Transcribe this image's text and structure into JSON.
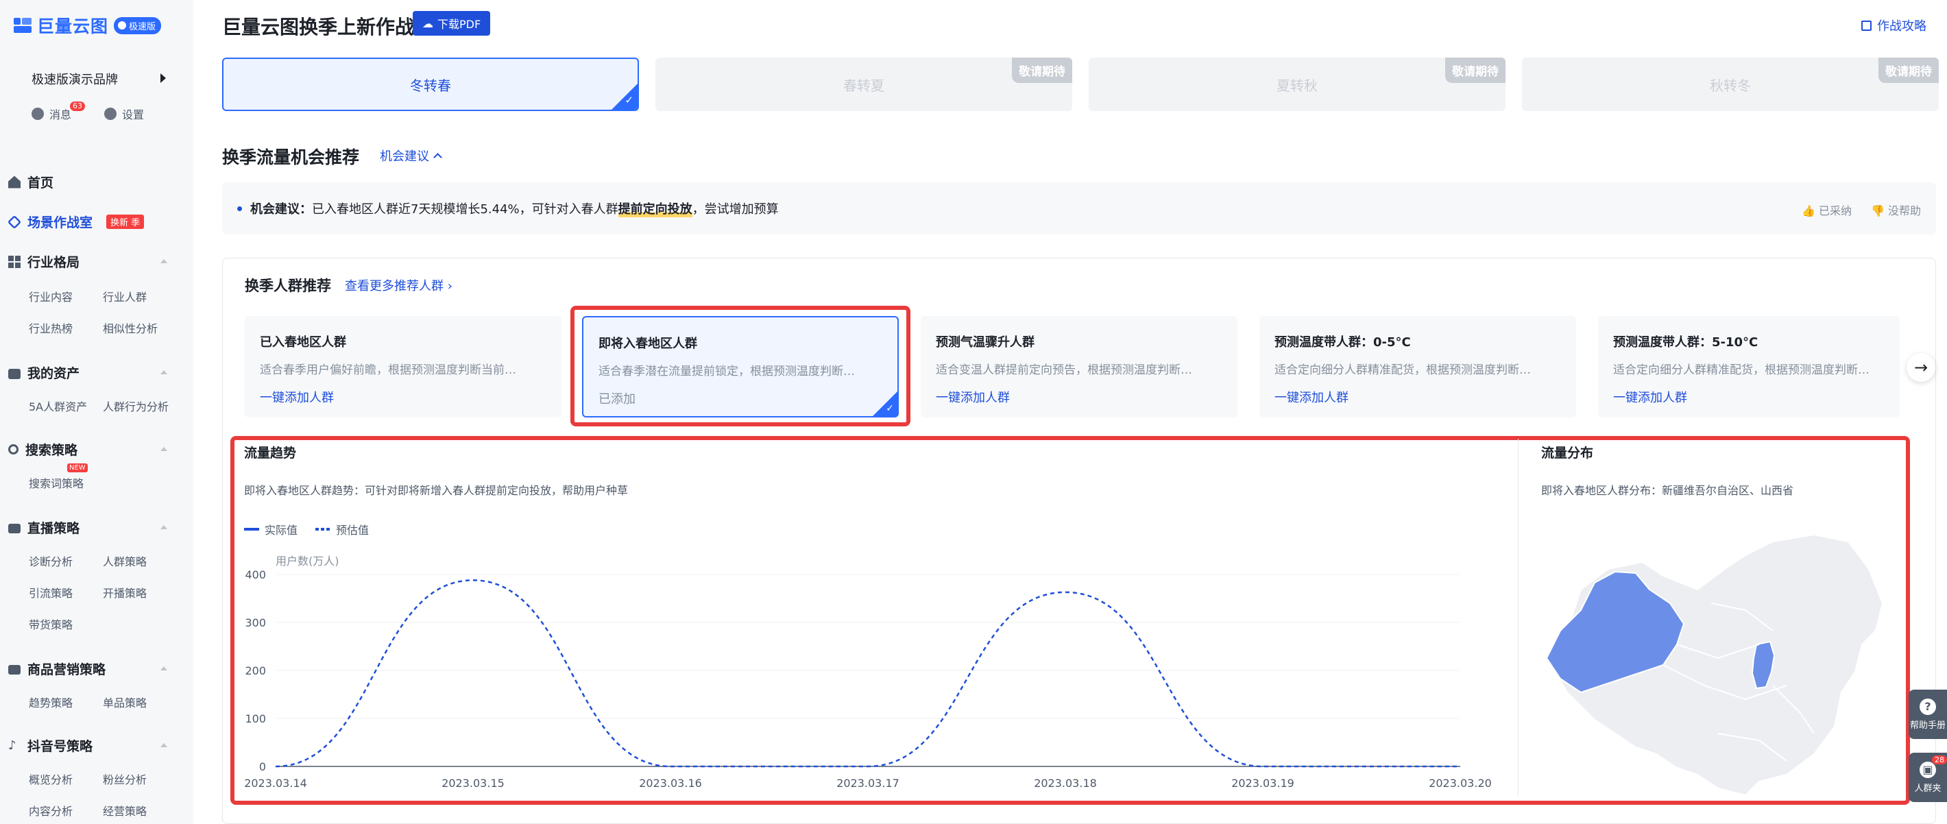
{
  "app": {
    "logo_text": "巨量云图",
    "logo_badge": "极速版",
    "brand": "极速版演示品牌",
    "messages_label": "消息",
    "messages_count": "63",
    "settings_label": "设置"
  },
  "sidebar": {
    "home": "首页",
    "scene": {
      "label": "场景作战室",
      "tag": "换新 季"
    },
    "industry": {
      "label": "行业格局",
      "items": [
        "行业内容",
        "行业人群",
        "行业热榜",
        "相似性分析"
      ]
    },
    "assets": {
      "label": "我的资产",
      "items": [
        "5A人群资产",
        "人群行为分析"
      ]
    },
    "search": {
      "label": "搜索策略",
      "items": [
        "搜索词策略"
      ],
      "new_tag": "NEW"
    },
    "live": {
      "label": "直播策略",
      "items": [
        "诊断分析",
        "人群策略",
        "引流策略",
        "开播策略",
        "带货策略"
      ]
    },
    "goods": {
      "label": "商品营销策略",
      "items": [
        "趋势策略",
        "单品策略"
      ]
    },
    "douyin": {
      "label": "抖音号策略",
      "items": [
        "概览分析",
        "粉丝分析",
        "内容分析",
        "经营策略"
      ]
    }
  },
  "header": {
    "title": "巨量云图换季上新作战",
    "pdf_button": "下载PDF",
    "guide_link": "作战攻略"
  },
  "seasons": [
    {
      "label": "冬转春",
      "active": true,
      "tag": ""
    },
    {
      "label": "春转夏",
      "active": false,
      "tag": "敬请期待"
    },
    {
      "label": "夏转秋",
      "active": false,
      "tag": "敬请期待"
    },
    {
      "label": "秋转冬",
      "active": false,
      "tag": "敬请期待"
    }
  ],
  "opportunity": {
    "title": "换季流量机会推荐",
    "toggle": "机会建议",
    "advice_label": "机会建议：",
    "advice_text": "已入春地区人群近7天规模增长5.44%，可针对入春人群",
    "advice_highlight": "提前定向投放",
    "advice_tail": "，尝试增加预算",
    "adopted": "已采纳",
    "unhelpful": "没帮助"
  },
  "audience": {
    "title": "换季人群推荐",
    "more_link": "查看更多推荐人群 ›",
    "cards": [
      {
        "title": "已入春地区人群",
        "desc": "适合春季用户偏好前瞻，根据预测温度判断当前…",
        "action": "一键添加人群"
      },
      {
        "title": "即将入春地区人群",
        "desc": "适合春季潜在流量提前锁定，根据预测温度判断…",
        "action": "已添加"
      },
      {
        "title": "预测气温骤升人群",
        "desc": "适合变温人群提前定向预告，根据预测温度判断…",
        "action": "一键添加人群"
      },
      {
        "title": "预测温度带人群：0-5°C",
        "desc": "适合定向细分人群精准配货，根据预测温度判断…",
        "action": "一键添加人群"
      },
      {
        "title": "预测温度带人群：5-10°C",
        "desc": "适合定向细分人群精准配货，根据预测温度判断…",
        "action": "一键添加人群"
      }
    ]
  },
  "trend": {
    "title": "流量趋势",
    "subtitle": "即将入春地区人群趋势：可针对即将新增入春人群提前定向投放，帮助用户种草",
    "legend_actual": "实际值",
    "legend_forecast": "预估值"
  },
  "distribution": {
    "title": "流量分布",
    "subtitle": "即将入春地区人群分布：新疆维吾尔自治区、山西省",
    "highlight_color": "#6b8fe8",
    "base_color": "#eceef2"
  },
  "floating": {
    "help": "帮助手册",
    "crowd": "人群夹",
    "crowd_count": "28"
  },
  "chart_data": {
    "type": "line",
    "ylabel": "用户数(万人)",
    "ylim": [
      0,
      400
    ],
    "yticks": [
      0,
      100,
      200,
      300,
      400
    ],
    "x": [
      "2023.03.14",
      "2023.03.15",
      "2023.03.16",
      "2023.03.17",
      "2023.03.18",
      "2023.03.19",
      "2023.03.20"
    ],
    "series": [
      {
        "name": "预估值",
        "style": "dashed",
        "color": "#1f4fd9",
        "values": [
          0,
          388,
          0,
          0,
          363,
          0,
          0
        ]
      }
    ],
    "grid": true
  }
}
